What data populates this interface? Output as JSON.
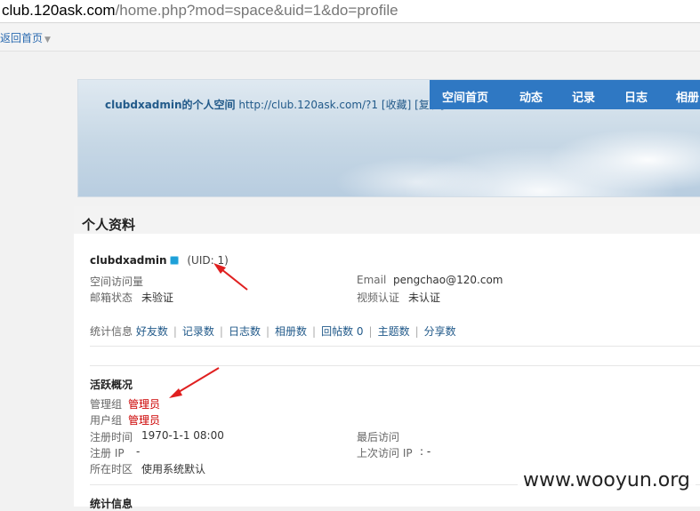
{
  "browser": {
    "url_domain": "club.120ask.com",
    "url_path": "/home.php?mod=space&uid=1&do=profile"
  },
  "topbar": {
    "back_home": "返回首页"
  },
  "banner": {
    "title": "clubdxadmin的个人空间",
    "url": "http://club.120ask.com/?1",
    "favorite": "[收藏]",
    "copy": "[复制]"
  },
  "nav": {
    "items": [
      "空间首页",
      "动态",
      "记录",
      "日志",
      "相册"
    ]
  },
  "profile": {
    "heading": "个人资料",
    "username": "clubdxadmin",
    "uid": "(UID: 1)",
    "visits_label": "空间访问量",
    "email_label": "Email",
    "email_value": "pengchao@120.com",
    "mail_status_label": "邮箱状态",
    "mail_status_value": "未验证",
    "video_label": "视频认证",
    "video_value": "未认证",
    "stats_label": "统计信息",
    "stats_links": [
      "好友数",
      "记录数",
      "日志数",
      "相册数",
      "回帖数 0",
      "主题数",
      "分享数"
    ]
  },
  "activity": {
    "heading": "活跃概况",
    "admin_group_label": "管理组",
    "admin_group_value": "管理员",
    "user_group_label": "用户组",
    "user_group_value": "管理员",
    "reg_time_label": "注册时间",
    "reg_time_value": "1970-1-1 08:00",
    "last_visit_label": "最后访问",
    "reg_ip_label": "注册 IP",
    "reg_ip_value": "-",
    "last_ip_label": "上次访问 IP",
    "last_ip_value": ": -",
    "timezone_label": "所在时区",
    "timezone_value": "使用系统默认"
  },
  "footer_heading": "统计信息",
  "watermark": "www.wooyun.org",
  "colors": {
    "nav_bg": "#2f78c3",
    "link": "#225a8a",
    "red": "#cc0000",
    "annotation": "#e02020"
  }
}
